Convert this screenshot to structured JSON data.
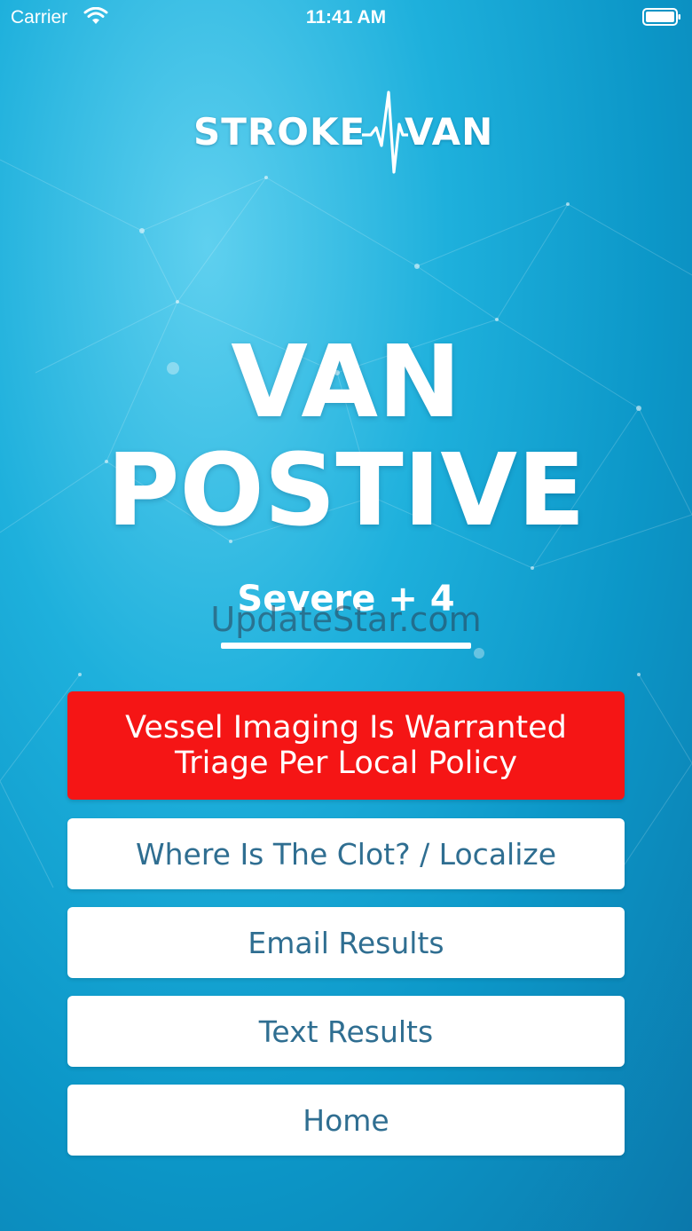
{
  "status_bar": {
    "carrier": "Carrier",
    "time": "11:41 AM"
  },
  "logo": {
    "left": "STROKE",
    "right": "VAN"
  },
  "result": {
    "line1": "VAN",
    "line2": "POSTIVE",
    "severity": "Severe + 4"
  },
  "watermark": "UpdateStar.com",
  "alert": {
    "line1": "Vessel Imaging Is Warranted",
    "line2": "Triage Per Local Policy",
    "color": "#f51515"
  },
  "buttons": [
    {
      "label": "Where Is The Clot? / Localize"
    },
    {
      "label": "Email Results"
    },
    {
      "label": "Text Results"
    },
    {
      "label": "Home"
    }
  ],
  "icons": [
    "wifi-icon",
    "battery-icon",
    "heartbeat-pulse-icon"
  ],
  "colors": {
    "background": "#1eb0dc",
    "button_text": "#2f6e91",
    "alert": "#f51515"
  }
}
